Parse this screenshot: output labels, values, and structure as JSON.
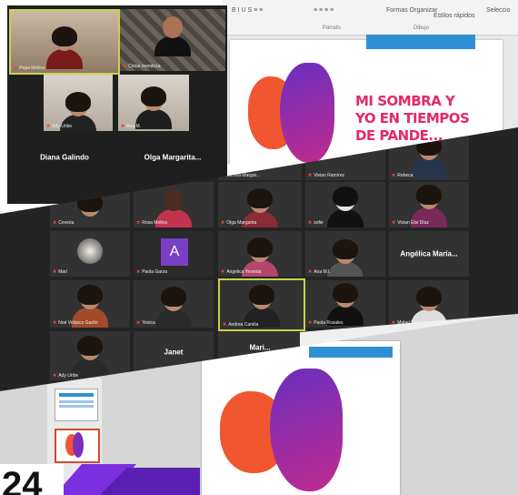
{
  "top_panel": {
    "tiles": [
      {
        "name": "Pepa Molina"
      },
      {
        "name": "César mendoza"
      },
      {
        "name": "Ady Uribe"
      },
      {
        "name": "Ana M."
      },
      {
        "name": "Diana Galindo"
      },
      {
        "name": "Olga  Margarita..."
      }
    ]
  },
  "slide": {
    "title_line1": "MI SOMBRA Y",
    "title_line2": "YO EN TIEMPOS",
    "title_line3": "DE PANDE..."
  },
  "ribbon": {
    "font_group": "Párrafo",
    "draw_group": "Dibujo",
    "organize": "Formas  Organizar",
    "quick": "Estilos rápidos",
    "select": "Seleccio"
  },
  "middle_panel": {
    "row1": [
      {
        "name": "Dienna Margar..."
      },
      {
        "name": "Vivian Ramírez"
      },
      {
        "name": "Rebeca"
      }
    ],
    "row2": [
      {
        "name": "Ceveria"
      },
      {
        "name": "Rosa Molina"
      },
      {
        "name": "Olga Margarita"
      },
      {
        "name": "sofie"
      },
      {
        "name": "Vivian Elsi Díaz"
      }
    ],
    "row3": [
      {
        "name": "Marl"
      },
      {
        "name": "Paola Garza",
        "initial": "A"
      },
      {
        "name": "Angelica Yesenia"
      },
      {
        "name": "Ana M.I."
      },
      {
        "name": "Angélica  María..."
      }
    ],
    "row4": [
      {
        "name": "Noé Velasco Gartín"
      },
      {
        "name": "Yesica"
      },
      {
        "name": "Andrea Camila"
      },
      {
        "name": "Paola Rosales"
      },
      {
        "name": "Mabel Rodríguez"
      }
    ],
    "row5": [
      {
        "name": "Ady Uribe"
      },
      {
        "name": "Janet"
      },
      {
        "name": "Mari..."
      }
    ]
  },
  "colors": {
    "slide_title": "#e4286c",
    "accent_blue": "#2f8fd6",
    "badge": "#7b2fe0"
  },
  "badge_text": "24"
}
